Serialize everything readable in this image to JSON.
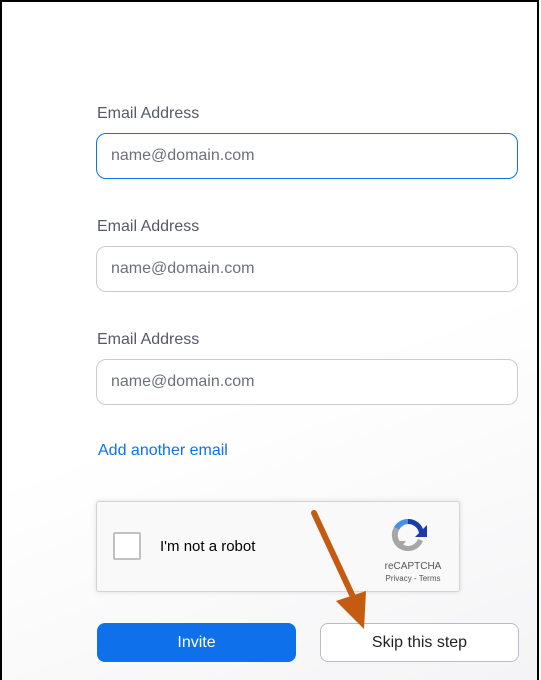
{
  "form": {
    "fields": [
      {
        "label": "Email Address",
        "placeholder": "name@domain.com",
        "value": ""
      },
      {
        "label": "Email Address",
        "placeholder": "name@domain.com",
        "value": ""
      },
      {
        "label": "Email Address",
        "placeholder": "name@domain.com",
        "value": ""
      }
    ],
    "add_email_link": "Add another email"
  },
  "recaptcha": {
    "checkbox_label": "I'm not a robot",
    "brand": "reCAPTCHA",
    "links": "Privacy - Terms",
    "checked": false
  },
  "actions": {
    "invite_label": "Invite",
    "skip_label": "Skip this step"
  },
  "annotation": {
    "arrow_color": "#c55a11",
    "arrow_icon": "arrow-down-left-icon"
  },
  "colors": {
    "accent": "#0e71eb",
    "recaptcha_blue": "#4a90e2",
    "recaptcha_gray": "#a6a6a6"
  }
}
